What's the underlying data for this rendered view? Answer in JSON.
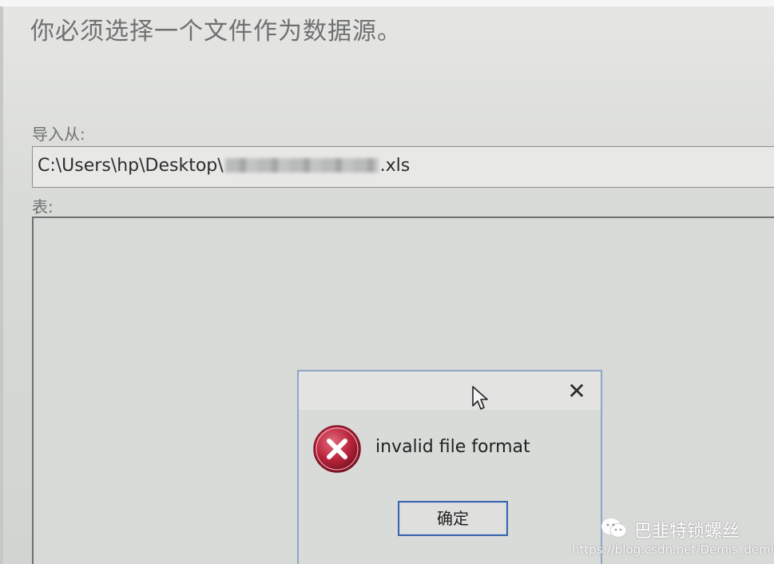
{
  "page": {
    "heading": "你必须选择一个文件作为数据源。",
    "import_label": "导入从:",
    "path_prefix": "C:\\Users\\hp\\Desktop\\",
    "path_suffix": ".xls",
    "table_label": "表:"
  },
  "dialog": {
    "close_symbol": "✕",
    "message": "invalid file format",
    "ok_label": "确定"
  },
  "watermark": {
    "name": "巴韭特锁螺丝",
    "url": "https://blog.csdn.net/Demis_demis"
  },
  "icons": {
    "error": "error-icon",
    "cursor": "mouse-cursor-icon",
    "close": "close-icon",
    "wechat": "wechat-icon"
  },
  "colors": {
    "error_red": "#b8233a",
    "button_border": "#3a63a8",
    "dialog_border": "#8ea6c6"
  }
}
